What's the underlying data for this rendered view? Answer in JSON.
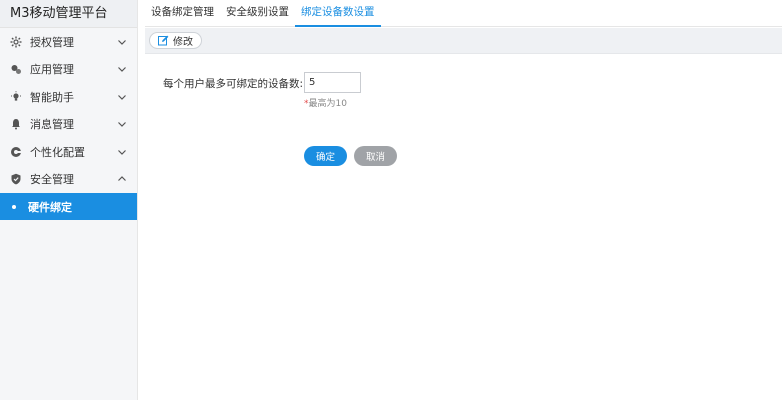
{
  "brand": {
    "title": "M3移动管理平台"
  },
  "sidebar": {
    "items": [
      {
        "label": "授权管理",
        "icon": "gear-icon",
        "chevron": "down"
      },
      {
        "label": "应用管理",
        "icon": "apps-icon",
        "chevron": "down"
      },
      {
        "label": "智能助手",
        "icon": "bulb-icon",
        "chevron": "down"
      },
      {
        "label": "消息管理",
        "icon": "bell-icon",
        "chevron": "down"
      },
      {
        "label": "个性化配置",
        "icon": "palette-icon",
        "chevron": "down"
      },
      {
        "label": "安全管理",
        "icon": "shield-icon",
        "chevron": "up"
      }
    ],
    "active_sub": {
      "label": "硬件绑定"
    }
  },
  "tabs": [
    {
      "label": "设备绑定管理"
    },
    {
      "label": "安全级别设置"
    },
    {
      "label": "绑定设备数设置",
      "active": true
    }
  ],
  "toolbar": {
    "edit_label": "修改"
  },
  "form": {
    "label": "每个用户最多可绑定的设备数:",
    "value": "5",
    "hint_mark": "*",
    "hint_text": "最高为10"
  },
  "actions": {
    "ok_label": "确定",
    "cancel_label": "取消"
  },
  "colors": {
    "accent": "#1a8ee1",
    "cancel": "#a0a3a7",
    "required": "#e34b4b"
  }
}
